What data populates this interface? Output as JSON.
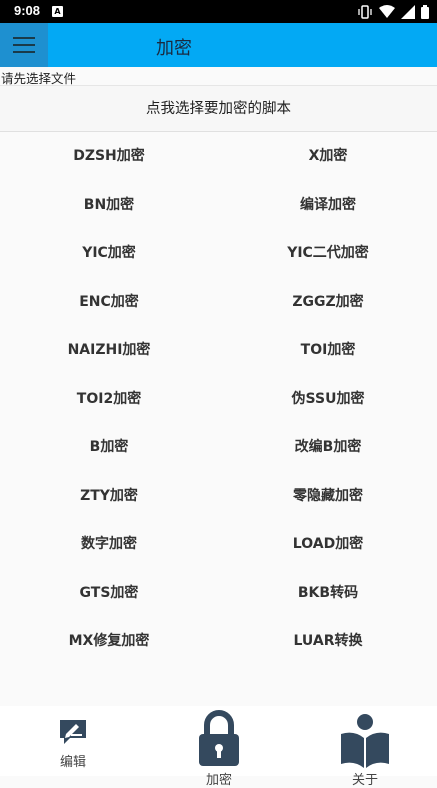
{
  "status_bar": {
    "time": "9:08",
    "notification_glyph": "A"
  },
  "app_bar": {
    "title": "加密"
  },
  "file_status": "请先选择文件",
  "pick_script_label": "点我选择要加密的脚本",
  "actions": [
    "DZSH加密",
    "X加密",
    "BN加密",
    "编译加密",
    "YIC加密",
    "YIC二代加密",
    "ENC加密",
    "ZGGZ加密",
    "NAIZHI加密",
    "TOI加密",
    "TOI2加密",
    "伪SSU加密",
    "B加密",
    "改编B加密",
    "ZTY加密",
    "零隐藏加密",
    "数字加密",
    "LOAD加密",
    "GTS加密",
    "BKB转码",
    "MX修复加密",
    "LUAR转换"
  ],
  "bottom_nav": [
    {
      "label": "编辑",
      "icon": "edit-icon"
    },
    {
      "label": "加密",
      "icon": "lock-icon"
    },
    {
      "label": "关于",
      "icon": "reader-icon"
    }
  ]
}
